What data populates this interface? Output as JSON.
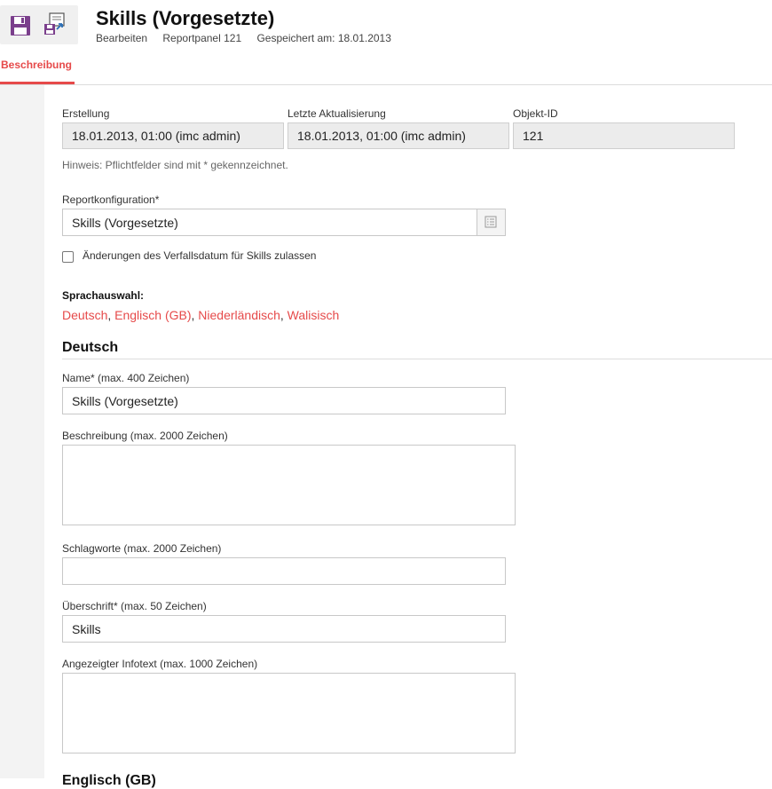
{
  "header": {
    "title": "Skills (Vorgesetzte)",
    "meta": {
      "mode": "Bearbeiten",
      "object": "Reportpanel 121",
      "saved": "Gespeichert am: 18.01.2013"
    }
  },
  "toolbar": {
    "save_icon": "floppy-disk-icon",
    "save_as_icon": "save-as-icon"
  },
  "tabs": [
    {
      "label": "Beschreibung",
      "active": true
    }
  ],
  "info": {
    "created_label": "Erstellung",
    "created_value": "18.01.2013, 01:00 (imc admin)",
    "updated_label": "Letzte Aktualisierung",
    "updated_value": "18.01.2013, 01:00 (imc admin)",
    "id_label": "Objekt-ID",
    "id_value": "121"
  },
  "hint": "Hinweis: Pflichtfelder sind mit * gekennzeichnet.",
  "report_config": {
    "label": "Reportkonfiguration*",
    "value": "Skills (Vorgesetzte)"
  },
  "allow_expiry_change": {
    "label": "Änderungen des Verfallsdatum für Skills zulassen",
    "checked": false
  },
  "language_selection": {
    "label": "Sprachauswahl:",
    "languages": [
      "Deutsch",
      "Englisch (GB)",
      "Niederländisch",
      "Walisisch"
    ]
  },
  "sections": {
    "deutsch": {
      "heading": "Deutsch",
      "name": {
        "label": "Name* (max. 400 Zeichen)",
        "value": "Skills (Vorgesetzte)"
      },
      "description": {
        "label": "Beschreibung (max. 2000 Zeichen)",
        "value": ""
      },
      "keywords": {
        "label": "Schlagworte (max. 2000 Zeichen)",
        "value": ""
      },
      "heading_field": {
        "label": "Überschrift* (max. 50 Zeichen)",
        "value": "Skills"
      },
      "infotext": {
        "label": "Angezeigter Infotext (max. 1000 Zeichen)",
        "value": ""
      }
    },
    "next_heading": "Englisch (GB)"
  },
  "colors": {
    "accent": "#e64a4a",
    "readonly_bg": "#ececec",
    "gutter": "#f3f3f3"
  }
}
